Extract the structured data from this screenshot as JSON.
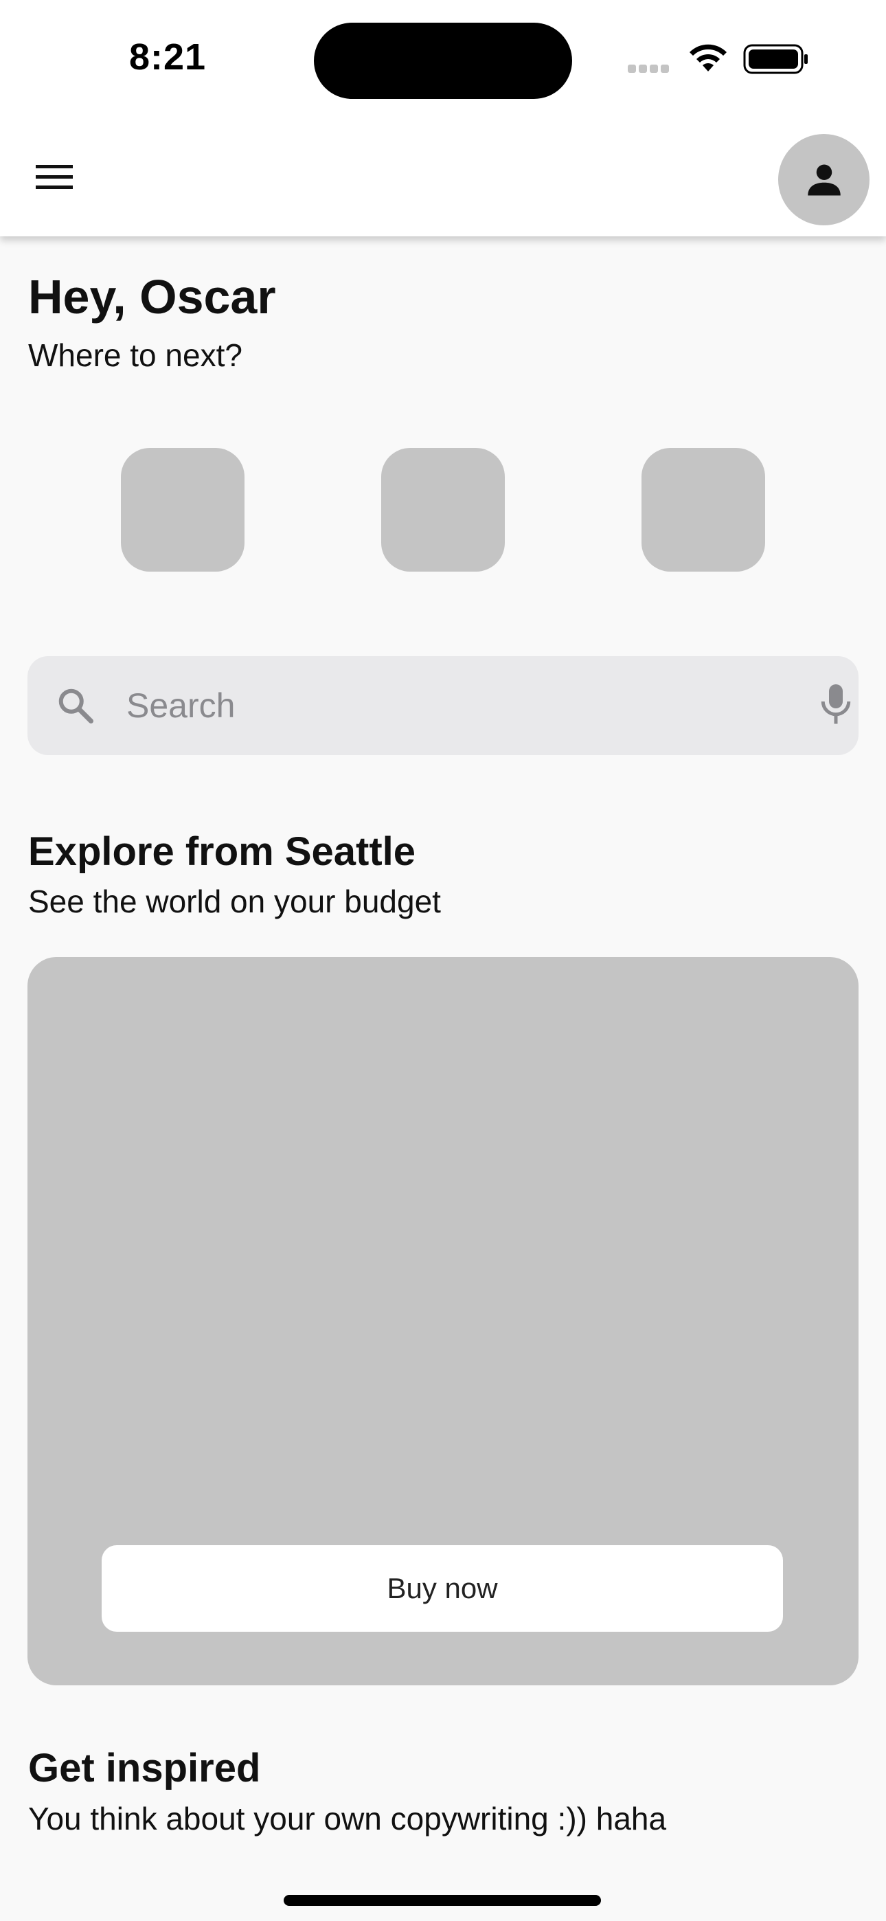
{
  "status_bar": {
    "time": "8:21"
  },
  "app_bar": {
    "menu_icon": "hamburger-menu-icon",
    "profile_icon": "person-icon"
  },
  "greeting": {
    "title": "Hey, Oscar",
    "subtitle": "Where to next?"
  },
  "quick_actions": [
    {
      "name": "quick-action-1"
    },
    {
      "name": "quick-action-2"
    },
    {
      "name": "quick-action-3"
    }
  ],
  "search": {
    "placeholder": "Search",
    "value": "",
    "icon": "search-icon",
    "voice_icon": "microphone-icon"
  },
  "explore": {
    "title": "Explore from Seattle",
    "subtitle": "See the world on your budget",
    "button_label": "Buy now"
  },
  "inspired": {
    "title": "Get inspired",
    "subtitle": "You think about your own copywriting :)) haha"
  },
  "colors": {
    "background": "#f9f9f9",
    "placeholder_gray": "#c4c4c4",
    "search_bg": "#e9e9eb"
  }
}
